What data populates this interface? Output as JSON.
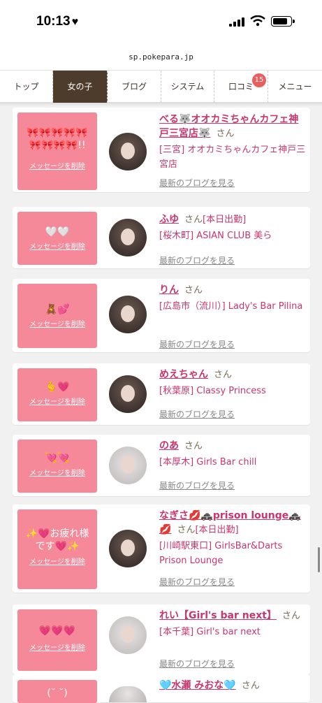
{
  "status": {
    "time": "10:13",
    "heart": "♥"
  },
  "browser": {
    "url": "sp.pokepara.jp"
  },
  "nav": {
    "tabs": [
      "トップ",
      "女の子",
      "ブログ",
      "システム",
      "口コミ",
      "メニュー"
    ],
    "active": "女の子",
    "review_badge": "15"
  },
  "common": {
    "delete_label": "メッセージを削除",
    "blog_label": "最新のブログを見る",
    "san": "さん"
  },
  "cards": [
    {
      "message": "🎀🎀🎀🎀🎀🎀🎀🎀🎀!!",
      "name": "べる🐺オオカミちゃんカフェ神戸三宮店🐺",
      "tag": "",
      "shop": "[三宮] オオカミちゃんカフェ神戸三宮店"
    },
    {
      "message": "🤍🤍",
      "name": "ふゆ",
      "tag": "[本日出勤]",
      "shop": "[桜木町] ASIAN CLUB 美ら"
    },
    {
      "message": "🧸💕",
      "name": "りん",
      "tag": "",
      "shop": "[広島市（流川）] Lady's Bar Pilina"
    },
    {
      "message": "🫰💗",
      "name": "めえちゃん",
      "tag": "",
      "shop": "[秋葉原] Classy Princess"
    },
    {
      "message": "💘💘",
      "name": "のあ",
      "tag": "",
      "shop": "[本厚木] Girls Bar chill"
    },
    {
      "message": "✨💗お疲れ様です💗✨",
      "name": "なぎさ💋🚓prison lounge🚓💋",
      "tag": "[本日出勤]",
      "shop": "[川崎駅東口] GirlsBar&Darts Prison Lounge"
    },
    {
      "message": "💗💗💗",
      "name": "れい【Girl's bar next】",
      "tag": "",
      "shop": "[本千葉] Girl's bar next"
    },
    {
      "message": "(˘ ˘)",
      "name": "🩵水瀬 みおな🩵",
      "tag": "",
      "shop": ""
    }
  ]
}
